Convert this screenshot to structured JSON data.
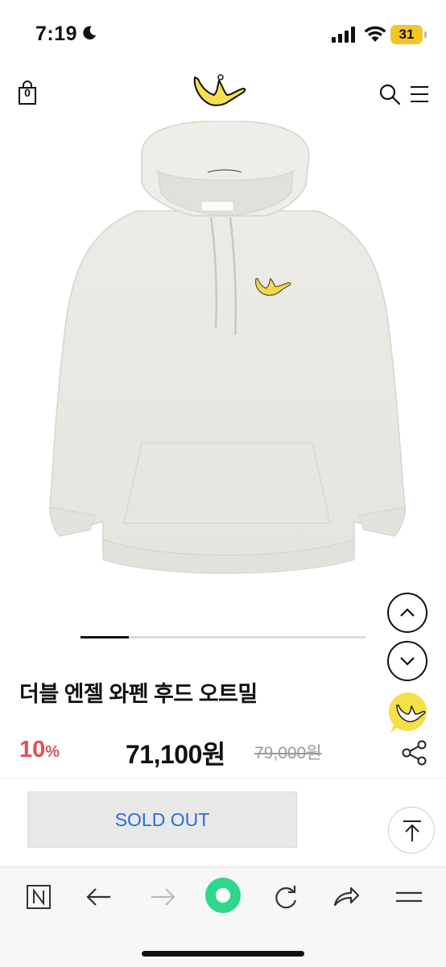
{
  "status_bar": {
    "time": "7:19",
    "battery": "31"
  },
  "header": {
    "cart_count": "0",
    "icons": [
      "shopping-bag-icon",
      "angel-logo",
      "search-icon",
      "menu-icon"
    ]
  },
  "product": {
    "image_alt": "oatmeal hoodie",
    "image_page_progress": 0.17,
    "title": "더블 엔젤 와펜 후드 오트밀",
    "discount_value": "10",
    "discount_unit": "%",
    "price": "71,100원",
    "original_price": "79,000원"
  },
  "actions": {
    "sold_out_label": "SOLD OUT"
  },
  "colors": {
    "discount": "#e05050",
    "sold_out_text": "#2a6fd0",
    "brand_yellow": "#f5e04a",
    "home_button": "#2dd88c"
  },
  "browser_toolbar": {
    "icons": [
      "naver-n-icon",
      "back-arrow-icon",
      "forward-arrow-icon",
      "home-circle-icon",
      "reload-icon",
      "share-arrow-icon",
      "hamburger-icon"
    ]
  }
}
